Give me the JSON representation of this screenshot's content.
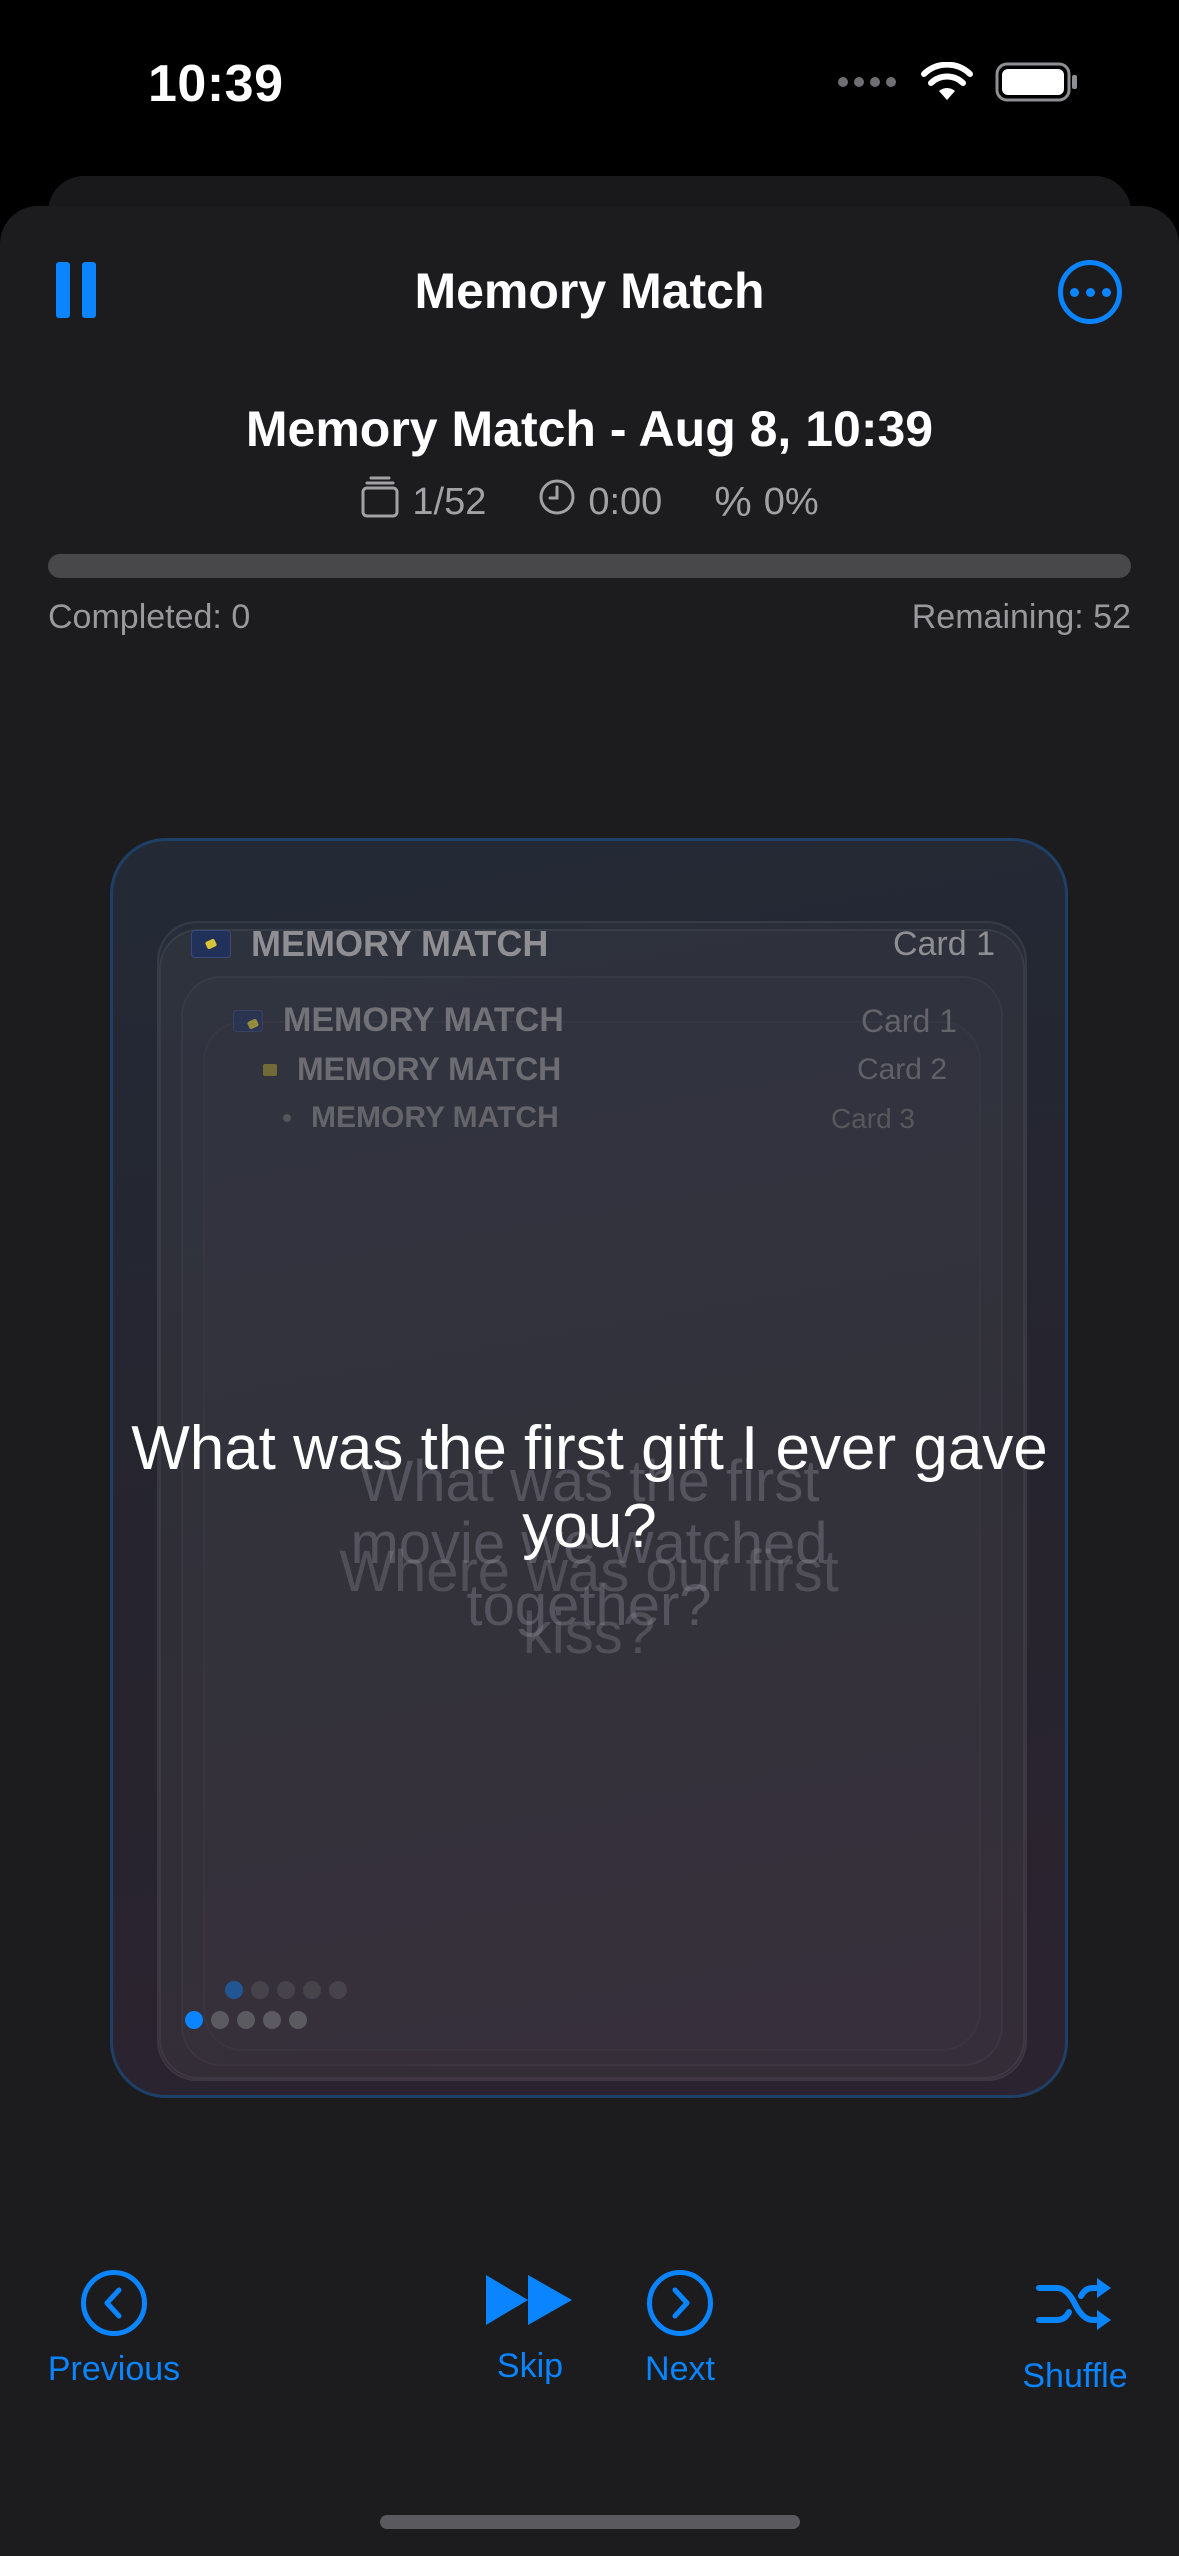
{
  "status_bar": {
    "time": "10:39"
  },
  "nav": {
    "title": "Memory Match"
  },
  "session": {
    "title": "Memory Match - Aug 8, 10:39",
    "card_count": "1/52",
    "timer": "0:00",
    "percent_symbol": "%",
    "percent": "0%"
  },
  "progress": {
    "value_fraction": 0,
    "completed_label": "Completed: 0",
    "remaining_label": "Remaining: 52"
  },
  "cards": {
    "back_layers": [
      {
        "header": "MEMORY MATCH",
        "card_label": "Card 1",
        "question": "Where was our first kiss?"
      },
      {
        "header": "MEMORY MATCH",
        "card_label": "Card 2",
        "question": "What was the first movie we watched together?"
      },
      {
        "header": "MEMORY MATCH",
        "card_label": "Card 3",
        "question": ""
      }
    ],
    "front": {
      "header": "MEMORY MATCH",
      "card_label": "Card 1",
      "question": "What was the first gift I ever gave you?"
    }
  },
  "toolbar": {
    "previous": "Previous",
    "skip": "Skip",
    "next": "Next",
    "shuffle": "Shuffle"
  },
  "colors": {
    "accent": "#0a84ff",
    "background": "#1c1c1e",
    "secondary_text": "#98989d"
  }
}
